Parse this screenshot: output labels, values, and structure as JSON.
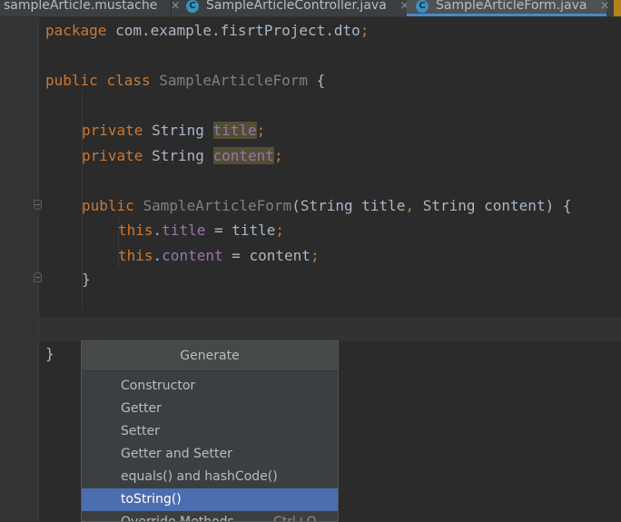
{
  "tabs": [
    {
      "label": "sampleArticle.mustache",
      "close": "×"
    },
    {
      "label": "SampleArticleController.java",
      "close": "×",
      "icon": "C"
    },
    {
      "label": "SampleArticleForm.java",
      "close": "×",
      "icon": "C",
      "active": true
    }
  ],
  "code": {
    "l1_kw": "package",
    "l1_rest": " com.example.fisrtProject.dto",
    "l1_semi": ";",
    "l2_kw1": "public",
    "l2_kw2": "class",
    "l2_cls": "SampleArticleForm",
    "l2_brace": " {",
    "l3_kw": "private",
    "l3_type": " String ",
    "l3_field": "title",
    "l3_semi": ";",
    "l4_kw": "private",
    "l4_type": " String ",
    "l4_field": "content",
    "l4_semi": ";",
    "l5_kw": "public",
    "l5_cls": "SampleArticleForm",
    "l5_p1": "(String title",
    "l5_comma": ",",
    "l5_p2": " String content) {",
    "l6_this": "this",
    "l6_dot": ".",
    "l6_field": "title",
    "l6_rest": " = title",
    "l6_semi": ";",
    "l7_this": "this",
    "l7_dot": ".",
    "l7_field": "content",
    "l7_rest": " = content",
    "l7_semi": ";",
    "l8_brace": "}",
    "l9_brace": "}"
  },
  "popup": {
    "title": "Generate",
    "items": [
      {
        "label": "Constructor"
      },
      {
        "label": "Getter"
      },
      {
        "label": "Setter"
      },
      {
        "label": "Getter and Setter"
      },
      {
        "label": "equals() and hashCode()"
      },
      {
        "label": "toString()",
        "selected": true
      },
      {
        "label": "Override Methods...",
        "shortcut": "Ctrl+O"
      }
    ]
  },
  "colors": {
    "editor_bg": "#2b2b2b",
    "keyword": "#cc7832",
    "field": "#9876aa",
    "text": "#a9b7c6",
    "selection": "#4b6eaf"
  }
}
